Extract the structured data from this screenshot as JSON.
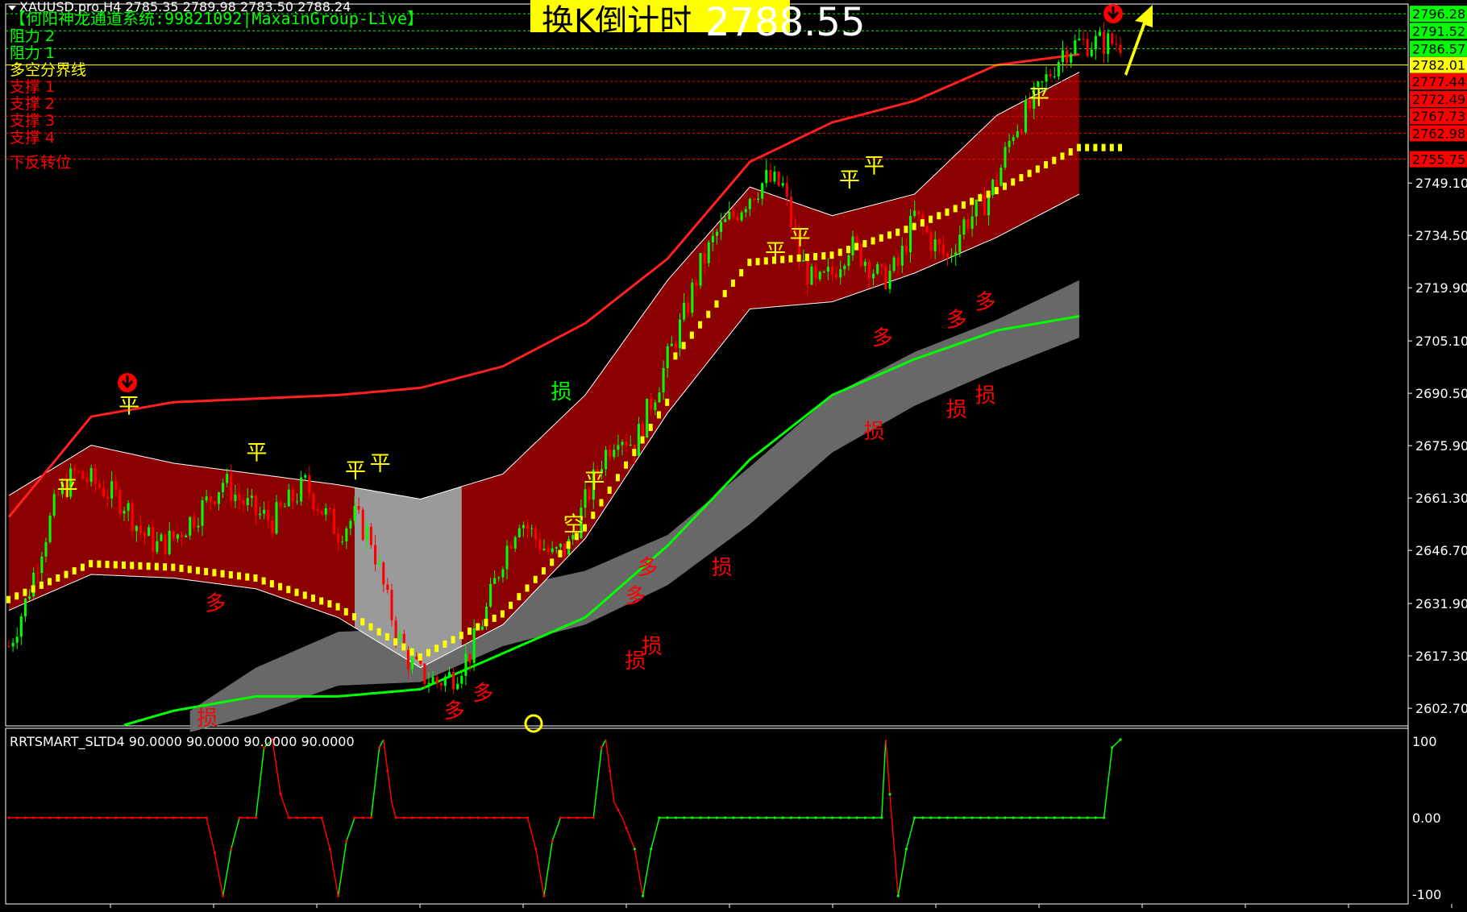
{
  "header": {
    "symbol_line": "XAUUSD.pro,H4  2785.35 2789.98 2783.50 2788.24",
    "system_label": "【何阳神龙通道系统:99821092|MaxainGroup-Live】",
    "countdown_label": "换K倒计时",
    "current_price": "2788.55"
  },
  "levels": [
    {
      "label": "阻力 2",
      "price": 2791.52,
      "price_text": "2791.52",
      "color": "#00ff00",
      "style": "dashed"
    },
    {
      "label": "阻力 1",
      "price": 2786.57,
      "price_text": "2786.57",
      "color": "#00ff00",
      "style": "dashed"
    },
    {
      "label": "多空分界线",
      "price": 2782.01,
      "price_text": "2782.01",
      "color": "#ffff00",
      "style": "solid"
    },
    {
      "label": "支撑 1",
      "price": 2777.44,
      "price_text": "2777.44",
      "color": "#ff0000",
      "style": "dashed"
    },
    {
      "label": "支撑 2",
      "price": 2772.49,
      "price_text": "2772.49",
      "color": "#ff0000",
      "style": "dashed"
    },
    {
      "label": "支撑 3",
      "price": 2767.73,
      "price_text": "2767.73",
      "color": "#ff0000",
      "style": "dashed"
    },
    {
      "label": "支撑 4",
      "price": 2762.98,
      "price_text": "2762.98",
      "color": "#ff0000",
      "style": "dashed"
    },
    {
      "label": "下反转位",
      "price": 2755.75,
      "price_text": "2755.75",
      "color": "#ff0000",
      "style": "dashed"
    }
  ],
  "top_level": {
    "price": 2796.28,
    "price_text": "2796.28",
    "color": "#00ff00"
  },
  "price_axis_ticks": [
    "2749.10",
    "2734.50",
    "2719.90",
    "2705.10",
    "2690.50",
    "2675.90",
    "2661.30",
    "2646.70",
    "2631.90",
    "2617.30",
    "2602.70"
  ],
  "indicator": {
    "title": "RRTSMART_SLTD4 90.0000 90.0000 90.0000 90.0000",
    "axis_ticks": [
      "100",
      "0.00",
      "-100"
    ],
    "ylim": [
      -100,
      100
    ]
  },
  "signals": {
    "ping": "平",
    "kong": "空",
    "duo": "多",
    "sun": "损"
  },
  "colors": {
    "background": "#000000",
    "bull_candle": "#00ff00",
    "bear_candle": "#ff0000",
    "channel_fill": "#8b0000",
    "grey_band": "#808080",
    "upper_line": "#ff2020",
    "ma_line": "#00ff00",
    "arrow": "#ffff00"
  },
  "chart_data": {
    "type": "candlestick",
    "symbol": "XAUUSD.pro",
    "timeframe": "H4",
    "last_bar": {
      "open": 2785.35,
      "high": 2789.98,
      "low": 2783.5,
      "close": 2788.24
    },
    "ylim": [
      2598,
      2799
    ],
    "y_ticks": [
      2749.1,
      2734.5,
      2719.9,
      2705.1,
      2690.5,
      2675.9,
      2661.3,
      2646.7,
      2631.9,
      2617.3,
      2602.7
    ],
    "close_path": [
      [
        0,
        2620
      ],
      [
        4,
        2632
      ],
      [
        8,
        2648
      ],
      [
        12,
        2662
      ],
      [
        16,
        2668
      ],
      [
        20,
        2666
      ],
      [
        24,
        2663
      ],
      [
        28,
        2660
      ],
      [
        32,
        2652
      ],
      [
        36,
        2648
      ],
      [
        40,
        2650
      ],
      [
        44,
        2655
      ],
      [
        48,
        2660
      ],
      [
        52,
        2666
      ],
      [
        56,
        2661
      ],
      [
        60,
        2657
      ],
      [
        64,
        2655
      ],
      [
        68,
        2660
      ],
      [
        72,
        2665
      ],
      [
        76,
        2658
      ],
      [
        80,
        2652
      ],
      [
        84,
        2656
      ],
      [
        88,
        2650
      ],
      [
        92,
        2632
      ],
      [
        96,
        2618
      ],
      [
        100,
        2612
      ],
      [
        104,
        2610
      ],
      [
        108,
        2612
      ],
      [
        112,
        2618
      ],
      [
        116,
        2630
      ],
      [
        120,
        2645
      ],
      [
        124,
        2656
      ],
      [
        128,
        2650
      ],
      [
        132,
        2645
      ],
      [
        136,
        2648
      ],
      [
        140,
        2660
      ],
      [
        144,
        2672
      ],
      [
        148,
        2680
      ],
      [
        152,
        2676
      ],
      [
        156,
        2688
      ],
      [
        160,
        2700
      ],
      [
        164,
        2712
      ],
      [
        168,
        2726
      ],
      [
        172,
        2735
      ],
      [
        176,
        2740
      ],
      [
        180,
        2746
      ],
      [
        184,
        2750
      ],
      [
        188,
        2748
      ],
      [
        192,
        2728
      ],
      [
        196,
        2720
      ],
      [
        200,
        2724
      ],
      [
        204,
        2732
      ],
      [
        208,
        2728
      ],
      [
        212,
        2722
      ],
      [
        216,
        2726
      ],
      [
        220,
        2740
      ],
      [
        224,
        2733
      ],
      [
        228,
        2728
      ],
      [
        232,
        2738
      ],
      [
        236,
        2742
      ],
      [
        240,
        2750
      ],
      [
        244,
        2764
      ],
      [
        248,
        2770
      ],
      [
        252,
        2778
      ],
      [
        256,
        2786
      ],
      [
        260,
        2788.24
      ]
    ],
    "channel_upper": [
      [
        0,
        2662
      ],
      [
        20,
        2676
      ],
      [
        40,
        2671
      ],
      [
        60,
        2668
      ],
      [
        80,
        2665
      ],
      [
        100,
        2661
      ],
      [
        120,
        2668
      ],
      [
        140,
        2690
      ],
      [
        160,
        2722
      ],
      [
        180,
        2748
      ],
      [
        200,
        2740
      ],
      [
        220,
        2746
      ],
      [
        240,
        2768
      ],
      [
        260,
        2780
      ]
    ],
    "channel_lower": [
      [
        0,
        2630
      ],
      [
        20,
        2640
      ],
      [
        40,
        2639
      ],
      [
        60,
        2636
      ],
      [
        80,
        2628
      ],
      [
        100,
        2614
      ],
      [
        120,
        2626
      ],
      [
        140,
        2650
      ],
      [
        160,
        2685
      ],
      [
        180,
        2714
      ],
      [
        200,
        2716
      ],
      [
        220,
        2724
      ],
      [
        240,
        2734
      ],
      [
        260,
        2746
      ]
    ],
    "upper_envelope": [
      [
        0,
        2656
      ],
      [
        20,
        2684
      ],
      [
        40,
        2688
      ],
      [
        60,
        2689
      ],
      [
        80,
        2690
      ],
      [
        100,
        2692
      ],
      [
        120,
        2698
      ],
      [
        140,
        2710
      ],
      [
        160,
        2728
      ],
      [
        180,
        2755
      ],
      [
        200,
        2766
      ],
      [
        220,
        2772
      ],
      [
        240,
        2782
      ],
      [
        260,
        2785
      ]
    ],
    "ma_line": [
      [
        28,
        2598
      ],
      [
        40,
        2602
      ],
      [
        60,
        2606
      ],
      [
        80,
        2606
      ],
      [
        100,
        2608
      ],
      [
        120,
        2618
      ],
      [
        140,
        2628
      ],
      [
        160,
        2648
      ],
      [
        180,
        2672
      ],
      [
        200,
        2690
      ],
      [
        220,
        2700
      ],
      [
        240,
        2708
      ],
      [
        260,
        2712
      ]
    ],
    "grey_band": [
      [
        44,
        2596,
        2602
      ],
      [
        60,
        2601,
        2614
      ],
      [
        80,
        2609,
        2624
      ],
      [
        100,
        2610,
        2625
      ],
      [
        120,
        2620,
        2636
      ],
      [
        140,
        2626,
        2641
      ],
      [
        160,
        2637,
        2651
      ],
      [
        180,
        2654,
        2670
      ],
      [
        200,
        2674,
        2690
      ],
      [
        220,
        2687,
        2702
      ],
      [
        240,
        2697,
        2711
      ],
      [
        260,
        2706,
        2722
      ]
    ],
    "signal_marks": [
      {
        "bar": 14,
        "price": 2662,
        "text": "平"
      },
      {
        "bar": 29,
        "price": 2685,
        "text": "平"
      },
      {
        "bar": 60,
        "price": 2672,
        "text": "平"
      },
      {
        "bar": 84,
        "price": 2667,
        "text": "平"
      },
      {
        "bar": 90,
        "price": 2669,
        "text": "平"
      },
      {
        "bar": 142,
        "price": 2664,
        "text": "平"
      },
      {
        "bar": 186,
        "price": 2728,
        "text": "平"
      },
      {
        "bar": 192,
        "price": 2732,
        "text": "平"
      },
      {
        "bar": 204,
        "price": 2748,
        "text": "平"
      },
      {
        "bar": 210,
        "price": 2752,
        "text": "平"
      },
      {
        "bar": 250,
        "price": 2771,
        "text": "平"
      },
      {
        "bar": 137,
        "price": 2652,
        "text": "空"
      },
      {
        "bar": 50,
        "price": 2630,
        "text": "多"
      },
      {
        "bar": 108,
        "price": 2600,
        "text": "多"
      },
      {
        "bar": 115,
        "price": 2605,
        "text": "多"
      },
      {
        "bar": 155,
        "price": 2640,
        "text": "多"
      },
      {
        "bar": 152,
        "price": 2632,
        "text": "多"
      },
      {
        "bar": 212,
        "price": 2704,
        "text": "多"
      },
      {
        "bar": 230,
        "price": 2709,
        "text": "多"
      },
      {
        "bar": 237,
        "price": 2714,
        "text": "多"
      },
      {
        "bar": 134,
        "price": 2689,
        "text": "损",
        "color": "#00ff00"
      },
      {
        "bar": 156,
        "price": 2618,
        "text": "损"
      },
      {
        "bar": 152,
        "price": 2614,
        "text": "损"
      },
      {
        "bar": 173,
        "price": 2640,
        "text": "损"
      },
      {
        "bar": 210,
        "price": 2678,
        "text": "损"
      },
      {
        "bar": 230,
        "price": 2684,
        "text": "损"
      },
      {
        "bar": 237,
        "price": 2688,
        "text": "损"
      },
      {
        "bar": 48,
        "price": 2598,
        "text": "损"
      }
    ],
    "indicator_series": [
      [
        0,
        0
      ],
      [
        48,
        0
      ],
      [
        50,
        -45
      ],
      [
        52,
        -100
      ],
      [
        54,
        -40
      ],
      [
        56,
        0
      ],
      [
        60,
        0
      ],
      [
        62,
        90
      ],
      [
        64,
        100
      ],
      [
        66,
        30
      ],
      [
        68,
        0
      ],
      [
        76,
        0
      ],
      [
        78,
        -40
      ],
      [
        80,
        -100
      ],
      [
        82,
        -30
      ],
      [
        84,
        0
      ],
      [
        88,
        0
      ],
      [
        90,
        90
      ],
      [
        91,
        100
      ],
      [
        93,
        20
      ],
      [
        94,
        0
      ],
      [
        126,
        0
      ],
      [
        128,
        -40
      ],
      [
        130,
        -100
      ],
      [
        132,
        -30
      ],
      [
        134,
        0
      ],
      [
        142,
        0
      ],
      [
        144,
        90
      ],
      [
        145,
        100
      ],
      [
        147,
        20
      ],
      [
        149,
        0
      ],
      [
        152,
        -40
      ],
      [
        154,
        -100
      ],
      [
        156,
        -40
      ],
      [
        158,
        0
      ],
      [
        212,
        0
      ],
      [
        213,
        100
      ],
      [
        214,
        30
      ],
      [
        216,
        -100
      ],
      [
        218,
        -40
      ],
      [
        220,
        0
      ],
      [
        266,
        0
      ],
      [
        268,
        90
      ],
      [
        270,
        100
      ]
    ]
  }
}
